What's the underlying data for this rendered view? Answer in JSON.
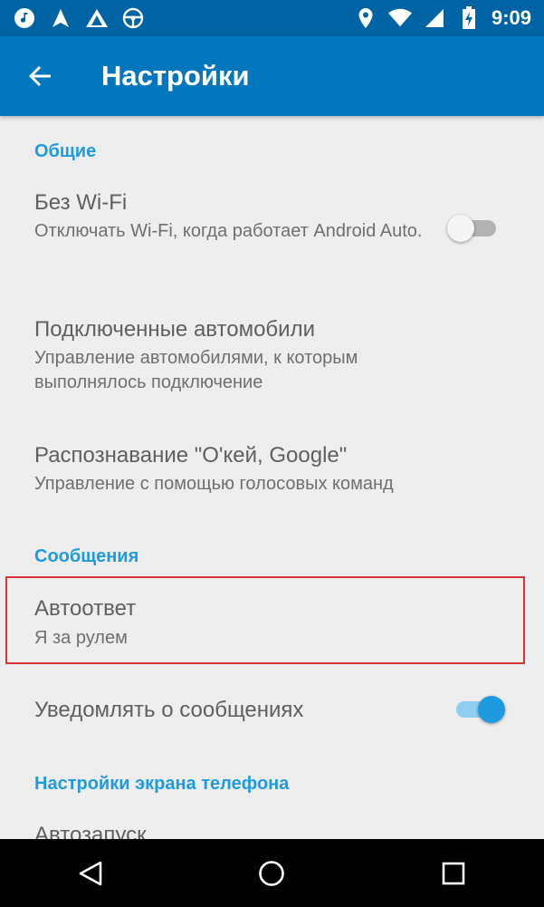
{
  "status_bar": {
    "time": "9:09",
    "left_icons": [
      "music-icon",
      "navigation-arrow-icon",
      "android-auto-icon",
      "steering-wheel-icon"
    ],
    "right_icons": [
      "location-icon",
      "wifi-icon",
      "cell-signal-icon",
      "battery-charging-icon"
    ]
  },
  "app_bar": {
    "title": "Настройки",
    "back_icon": "arrow-back-icon",
    "color": "#0277bd"
  },
  "sections": {
    "general": {
      "header": "Общие",
      "wifi": {
        "title": "Без Wi-Fi",
        "summary": "Отключать Wi-Fi, когда работает Android Auto.",
        "enabled": false
      },
      "cars": {
        "title": "Подключенные автомобили",
        "summary": "Управление автомобилями, к которым выполнялось подключение"
      },
      "ok_google": {
        "title": "Распознавание \"О'кей, Google\"",
        "summary": "Управление с помощью голосовых команд"
      }
    },
    "messages": {
      "header": "Сообщения",
      "autoreply": {
        "title": "Автоответ",
        "summary": "Я за рулем"
      },
      "notify": {
        "title": "Уведомлять о сообщениях",
        "enabled": true
      }
    },
    "phone_screen": {
      "header": "Настройки экрана телефона",
      "autostart": {
        "title": "Автозапуск"
      }
    }
  },
  "colors": {
    "accent": "#1e9be0",
    "highlight": "#d8333a",
    "status_bar": "#0063a3"
  },
  "nav_bar": {
    "icons": [
      "back-triangle-icon",
      "home-circle-icon",
      "recents-square-icon"
    ]
  }
}
